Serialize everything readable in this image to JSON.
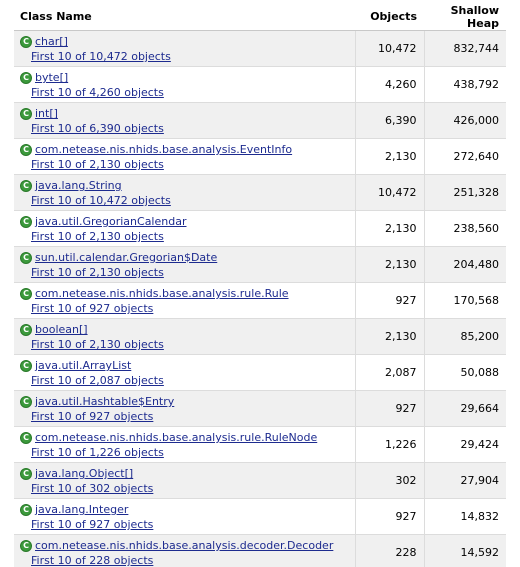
{
  "table": {
    "headers": {
      "class_name": "Class Name",
      "objects": "Objects",
      "shallow_heap": "Shallow Heap"
    },
    "icon_letter": "C",
    "rows": [
      {
        "class": "char[]",
        "first": "First 10 of 10,472 objects",
        "objects": "10,472",
        "heap": "832,744"
      },
      {
        "class": "byte[]",
        "first": "First 10 of 4,260 objects",
        "objects": "4,260",
        "heap": "438,792"
      },
      {
        "class": "int[]",
        "first": "First 10 of 6,390 objects",
        "objects": "6,390",
        "heap": "426,000"
      },
      {
        "class": "com.netease.nis.nhids.base.analysis.EventInfo",
        "first": "First 10 of 2,130 objects",
        "objects": "2,130",
        "heap": "272,640"
      },
      {
        "class": "java.lang.String",
        "first": "First 10 of 10,472 objects",
        "objects": "10,472",
        "heap": "251,328"
      },
      {
        "class": "java.util.GregorianCalendar",
        "first": "First 10 of 2,130 objects",
        "objects": "2,130",
        "heap": "238,560"
      },
      {
        "class": "sun.util.calendar.Gregorian$Date",
        "first": "First 10 of 2,130 objects",
        "objects": "2,130",
        "heap": "204,480"
      },
      {
        "class": "com.netease.nis.nhids.base.analysis.rule.Rule",
        "first": "First 10 of 927 objects",
        "objects": "927",
        "heap": "170,568"
      },
      {
        "class": "boolean[]",
        "first": "First 10 of 2,130 objects",
        "objects": "2,130",
        "heap": "85,200"
      },
      {
        "class": "java.util.ArrayList",
        "first": "First 10 of 2,087 objects",
        "objects": "2,087",
        "heap": "50,088"
      },
      {
        "class": "java.util.Hashtable$Entry",
        "first": "First 10 of 927 objects",
        "objects": "927",
        "heap": "29,664"
      },
      {
        "class": "com.netease.nis.nhids.base.analysis.rule.RuleNode",
        "first": "First 10 of 1,226 objects",
        "objects": "1,226",
        "heap": "29,424"
      },
      {
        "class": "java.lang.Object[]",
        "first": "First 10 of 302 objects",
        "objects": "302",
        "heap": "27,904"
      },
      {
        "class": "java.lang.Integer",
        "first": "First 10 of 927 objects",
        "objects": "927",
        "heap": "14,832"
      },
      {
        "class": "com.netease.nis.nhids.base.analysis.decoder.Decoder",
        "first": "First 10 of 228 objects",
        "objects": "228",
        "heap": "14,592"
      }
    ]
  }
}
